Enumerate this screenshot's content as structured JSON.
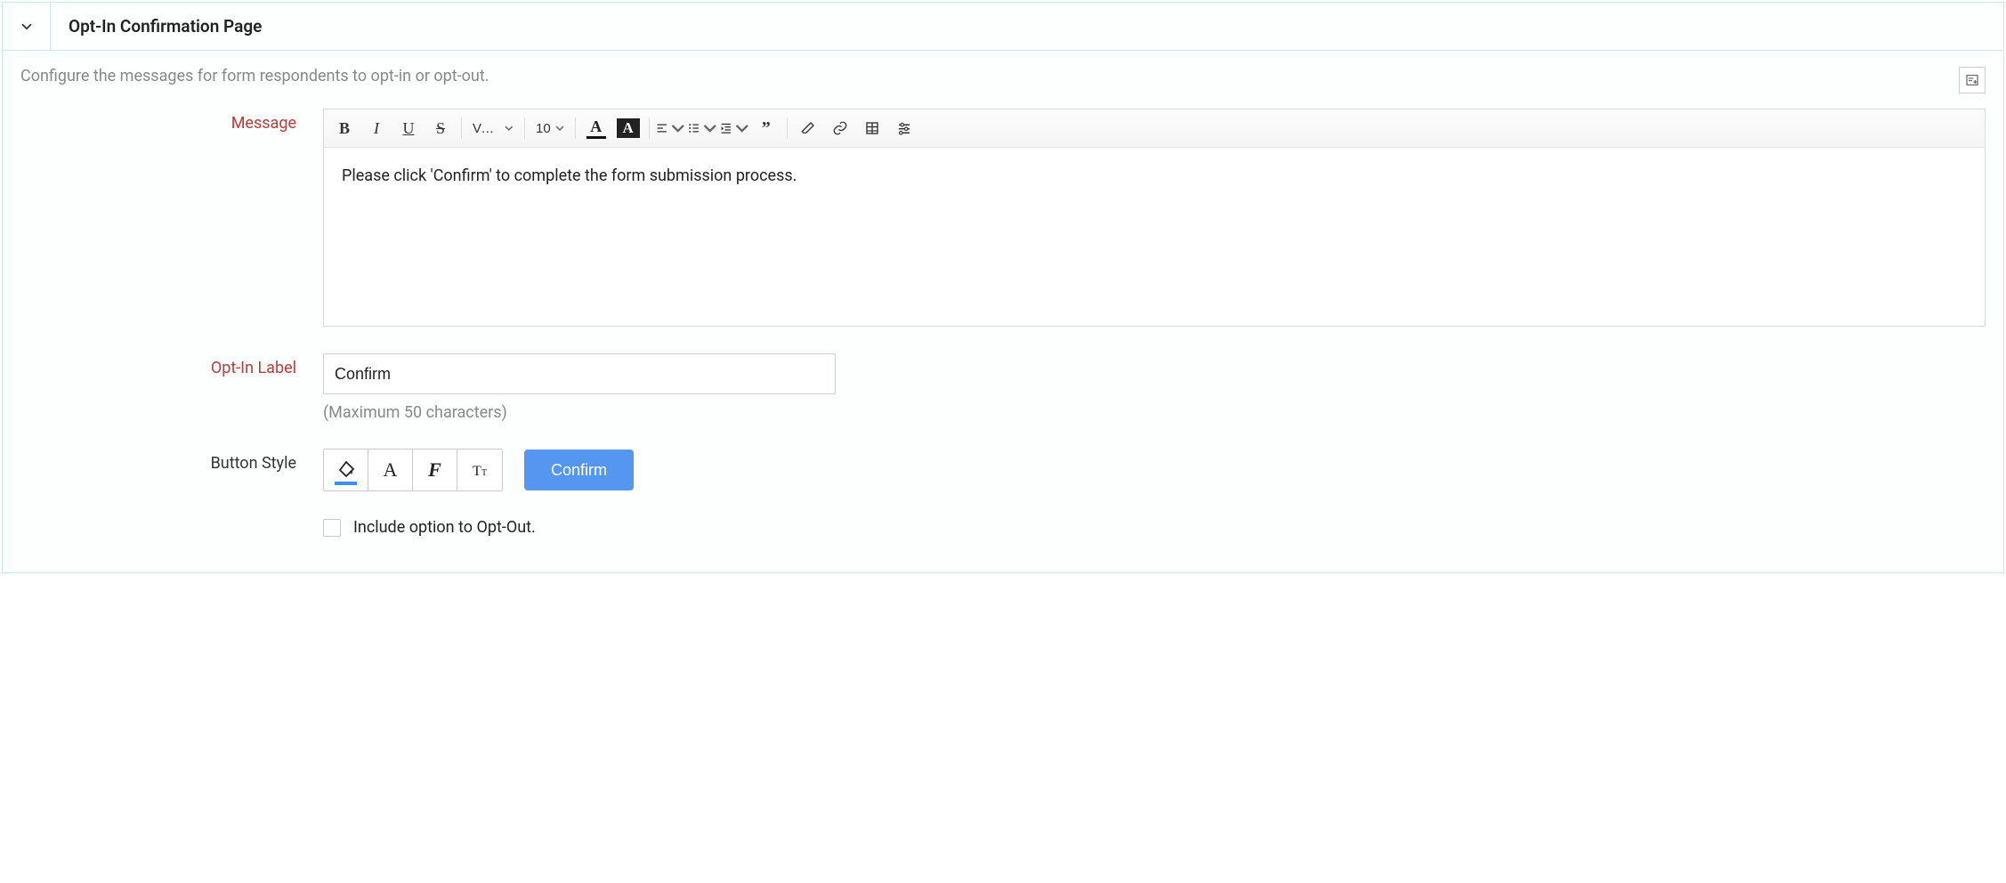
{
  "header": {
    "title": "Opt-In Confirmation Page"
  },
  "hint": "Configure the messages for form respondents to opt-in or opt-out.",
  "labels": {
    "message": "Message",
    "optInLabel": "Opt-In Label",
    "buttonStyle": "Button Style"
  },
  "toolbar": {
    "fontFamily": "Ve…",
    "fontSize": "10"
  },
  "message": {
    "content": "Please click 'Confirm' to complete the form submission process."
  },
  "optIn": {
    "value": "Confirm",
    "help": "(Maximum 50 characters)"
  },
  "preview": {
    "buttonLabel": "Confirm"
  },
  "optOut": {
    "checkboxLabel": "Include option to Opt-Out.",
    "checked": false
  }
}
